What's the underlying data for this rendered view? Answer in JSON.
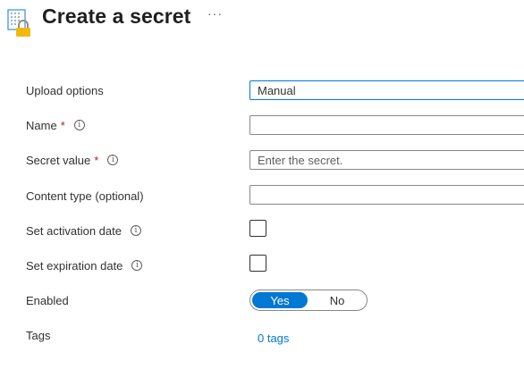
{
  "header": {
    "title": "Create a secret",
    "more_label": "···"
  },
  "form": {
    "upload_options": {
      "label": "Upload options",
      "value": "Manual"
    },
    "name": {
      "label": "Name",
      "required_mark": "*",
      "value": ""
    },
    "secret_value": {
      "label": "Secret value",
      "required_mark": "*",
      "placeholder": "Enter the secret."
    },
    "content_type": {
      "label": "Content type (optional)",
      "value": ""
    },
    "activation_date": {
      "label": "Set activation date",
      "checked": false
    },
    "expiration_date": {
      "label": "Set expiration date",
      "checked": false
    },
    "enabled": {
      "label": "Enabled",
      "yes_label": "Yes",
      "no_label": "No",
      "selected": "Yes"
    },
    "tags": {
      "label": "Tags",
      "link": "0 tags"
    }
  },
  "icons": {
    "info": "info-icon",
    "vault": "key-vault-icon"
  },
  "colors": {
    "accent": "#0078d4",
    "required": "#a4262c",
    "lock": "#f2b90d"
  }
}
